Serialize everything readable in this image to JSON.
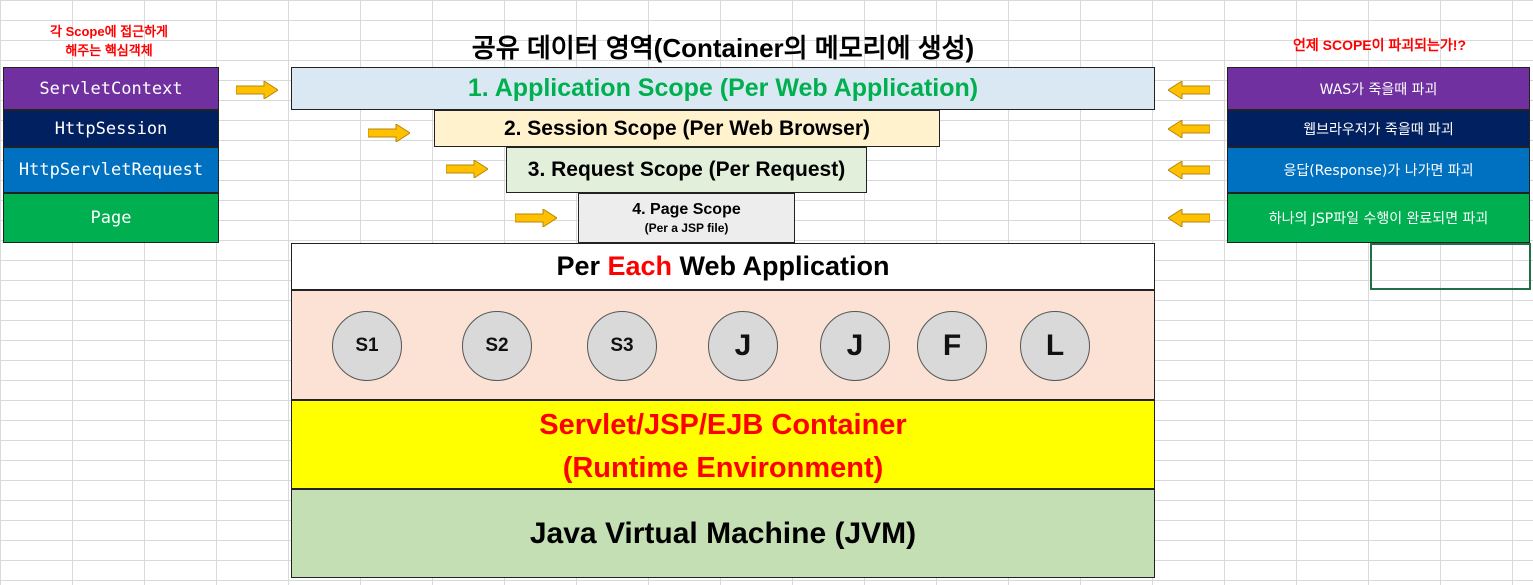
{
  "left_note": {
    "line1": "각 Scope에 접근하게",
    "line2": "해주는 핵심객체"
  },
  "title": "공유 데이터 영역(Container의 메모리에 생성)",
  "right_note": "언제 SCOPE이 파괴되는가!?",
  "objects": [
    {
      "label": "ServletContext",
      "color": "#7030a0"
    },
    {
      "label": "HttpSession",
      "color": "#002060"
    },
    {
      "label": "HttpServletRequest",
      "color": "#0070c0"
    },
    {
      "label": "Page",
      "color": "#00b050"
    }
  ],
  "scopes": [
    {
      "label": "1. Application Scope (Per Web Application)",
      "color": "#00b050",
      "bg": "#dae8f3"
    },
    {
      "label": "2. Session Scope (Per Web Browser)",
      "color": "#000000",
      "bg": "#fff2cc"
    },
    {
      "label": "3. Request Scope (Per Request)",
      "color": "#000000",
      "bg": "#e2efda"
    },
    {
      "label": "4. Page Scope",
      "sub": "(Per a JSP file)",
      "color": "#000000",
      "bg": "#ededed"
    }
  ],
  "destroy": [
    {
      "label": "WAS가 죽을때 파괴",
      "color": "#7030a0"
    },
    {
      "label": "웹브라우저가 죽을때 파괴",
      "color": "#002060"
    },
    {
      "label": "응답(Response)가 나가면 파괴",
      "color": "#0070c0"
    },
    {
      "label": "하나의 JSP파일 수행이 완료되면 파괴",
      "color": "#00b050"
    }
  ],
  "per_app": {
    "before": "Per ",
    "highlight": "Each",
    "after": " Web Application"
  },
  "components": [
    "S1",
    "S2",
    "S3",
    "J",
    "J",
    "F",
    "L"
  ],
  "container": {
    "line1": "Servlet/JSP/EJB Container",
    "line2": "(Runtime Environment)"
  },
  "jvm": "Java Virtual Machine (JVM)",
  "colors": {
    "arrow_fill": "#ffc000",
    "arrow_stroke": "#b7860b",
    "highlight_red": "#ff0000",
    "components_bg": "#fbe2d5",
    "container_bg": "#ffff00",
    "jvm_bg": "#c5dfb4"
  }
}
